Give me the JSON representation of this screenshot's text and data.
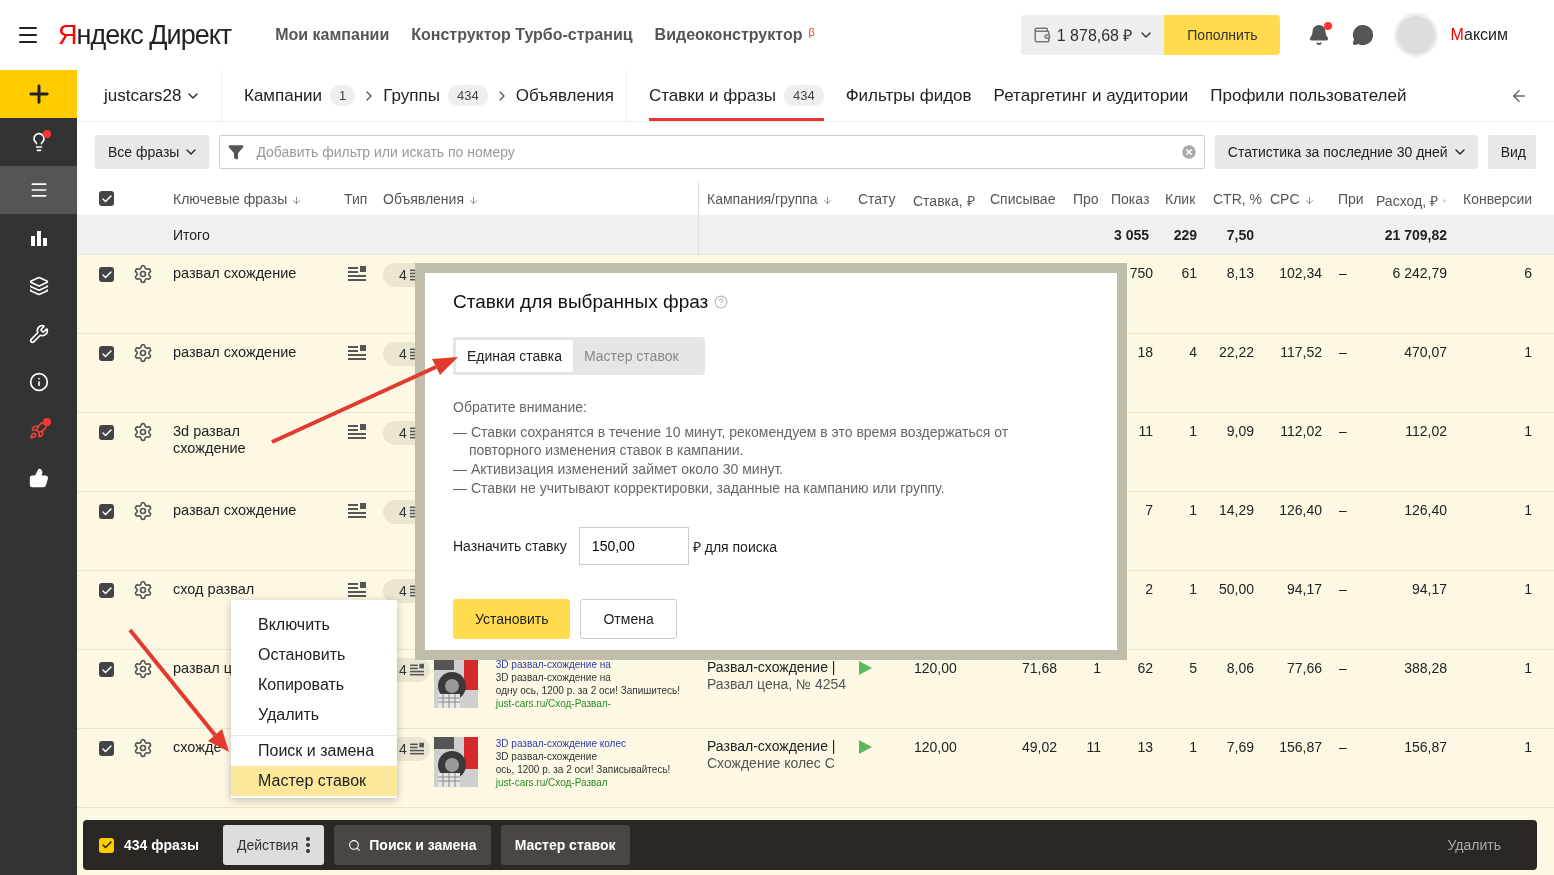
{
  "header": {
    "brand": "Яндекс Директ",
    "nav": [
      {
        "label": "Мои кампании"
      },
      {
        "label": "Конструктор Турбо-страниц"
      },
      {
        "label": "Видеоконструктор",
        "mark": "β"
      }
    ],
    "balance": "1 878,68 ₽",
    "top_up": "Пополнить",
    "notifications_unread": true,
    "user": "Максим"
  },
  "sidebar": {
    "items": [
      {
        "selected": false,
        "badge": true
      },
      {
        "selected": true,
        "badge": false
      },
      {
        "selected": false,
        "badge": false
      },
      {
        "selected": false,
        "badge": false
      },
      {
        "selected": false,
        "badge": false
      },
      {
        "selected": false,
        "badge": false
      },
      {
        "selected": false,
        "badge": true
      },
      {
        "selected": false,
        "badge": false
      }
    ]
  },
  "account": "justcars28",
  "breadcrumbs": [
    {
      "label": "Кампании",
      "count": "1"
    },
    {
      "label": "Группы",
      "count": "434"
    },
    {
      "label": "Объявления"
    }
  ],
  "tabs": [
    {
      "label": "Ставки и фразы",
      "count": "434",
      "selected": true
    },
    {
      "label": "Фильтры фидов",
      "selected": false
    },
    {
      "label": "Ретаргетинг и аудитории",
      "selected": false
    },
    {
      "label": "Профили пользователей",
      "selected": false
    }
  ],
  "filters": {
    "phrase_filter": "Все фразы",
    "search": {
      "placeholder": "Добавить фильтр или искать по номеру"
    },
    "period": "Статистика за последние 30 дней",
    "view": "Вид"
  },
  "table": {
    "header_checked": true,
    "columns": [
      {
        "label": "Ключевые фразы",
        "sortable": true
      },
      {
        "label": "Тип"
      },
      {
        "label": "Объявления",
        "sortable": true
      },
      {
        "label": "Кампания/группа",
        "sortable": true
      },
      {
        "label": "Стату"
      },
      {
        "label": "Ставка, ₽"
      },
      {
        "label": "Списывае"
      },
      {
        "label": "Про"
      },
      {
        "label": "Показ"
      },
      {
        "label": "Клик"
      },
      {
        "label": "CTR, %"
      },
      {
        "label": "CPC",
        "sortable": true
      },
      {
        "label": "При"
      },
      {
        "label": "Расход, ₽",
        "sortable": true
      },
      {
        "label": "Конверсии"
      }
    ],
    "total": {
      "label": "Итого",
      "shows": "3 055",
      "clicks": "229",
      "ctr": "7,50",
      "spend": "21 709,82"
    },
    "rows": [
      {
        "checked": true,
        "phrase": "развал схождение",
        "type_icon": true,
        "ads_count": "4",
        "shows": "750",
        "clicks": "61",
        "ctr": "8,13",
        "cpc": "102,34",
        "pri": "–",
        "spend": "6 242,79",
        "conv": "6"
      },
      {
        "checked": true,
        "phrase": "развал схождение",
        "type_icon": true,
        "ads_count": "4",
        "shows": "18",
        "clicks": "4",
        "ctr": "22,22",
        "cpc": "117,52",
        "pri": "–",
        "spend": "470,07",
        "conv": "1"
      },
      {
        "checked": true,
        "phrase": "3d развал схождение",
        "type_icon": true,
        "ads_count": "4",
        "shows": "11",
        "clicks": "1",
        "ctr": "9,09",
        "cpc": "112,02",
        "pri": "–",
        "spend": "112,02",
        "conv": "1"
      },
      {
        "checked": true,
        "phrase": "развал схождение",
        "type_icon": true,
        "ads_count": "4",
        "shows": "7",
        "clicks": "1",
        "ctr": "14,29",
        "cpc": "126,40",
        "pri": "–",
        "spend": "126,40",
        "conv": "1"
      },
      {
        "checked": true,
        "phrase": "сход развал",
        "type_icon": true,
        "ads_count": "4",
        "shows": "2",
        "clicks": "1",
        "ctr": "50,00",
        "cpc": "94,17",
        "pri": "–",
        "spend": "94,17",
        "conv": "1"
      },
      {
        "checked": true,
        "phrase": "развал ц",
        "ads_count": "4",
        "ad": {
          "title": "3D развал-схождение на",
          "lines": [
            "3D развал-схождение на",
            "одну ось, 1200 р. за 2 оси! Запишитесь!"
          ],
          "url": "just-cars.ru/Сход-Развал-"
        },
        "campaign": [
          "Развал-схождение |",
          "Развал цена, № 4254"
        ],
        "running": true,
        "bid": "120,00",
        "spent": "71,68",
        "pro": "1",
        "shows": "62",
        "clicks": "5",
        "ctr": "8,06",
        "cpc": "77,66",
        "pri": "–",
        "spend": "388,28",
        "conv": "1"
      },
      {
        "checked": true,
        "phrase": "схожде",
        "ads_count": "4",
        "ad": {
          "title": "3D развал-схождение колес",
          "lines": [
            "3D развал-схождение",
            "ось, 1200 р. за 2 оси! Записывайтесь!"
          ],
          "url": "just-cars.ru/Сход-Развал"
        },
        "campaign": [
          "Развал-схождение |",
          "Схождение колес С"
        ],
        "running": true,
        "bid": "120,00",
        "spent": "49,02",
        "pro": "11",
        "shows": "13",
        "clicks": "1",
        "ctr": "7,69",
        "cpc": "156,87",
        "pri": "–",
        "spend": "156,87",
        "conv": "1"
      }
    ]
  },
  "bid_dialog": {
    "title": "Ставки для выбранных фраз",
    "tabs": [
      {
        "label": "Единая ставка",
        "selected": true
      },
      {
        "label": "Мастер ставок",
        "selected": false
      }
    ],
    "note_title": "Обратите внимание:",
    "notes": [
      "— Ставки сохранятся в течение 10 минут, рекомендуем в это время воздержаться от повторного изменения ставок в кампании.",
      "— Активизация изменений займет около 30 минут.",
      "— Ставки не учитывают корректировки, заданные на кампанию или группу."
    ],
    "bid_label": "Назначить ставку",
    "bid_value": "150,00",
    "bid_suffix": "₽ для поиска",
    "buttons": [
      {
        "label": "Установить",
        "primary": true
      },
      {
        "label": "Отмена",
        "primary": false
      }
    ]
  },
  "actions_menu": {
    "items": [
      {
        "label": "Включить",
        "highlighted": false
      },
      {
        "label": "Остановить",
        "highlighted": false
      },
      {
        "label": "Копировать",
        "highlighted": false
      },
      {
        "label": "Удалить",
        "highlighted": false
      },
      {
        "label": "Поиск и замена",
        "highlighted": false,
        "separator_before": true
      },
      {
        "label": "Мастер ставок",
        "highlighted": true
      }
    ]
  },
  "selection_bar": {
    "checked": true,
    "count": "434 фразы",
    "actions": "Действия",
    "buttons": [
      "Поиск и замена",
      "Мастер ставок"
    ],
    "delete": "Удалить"
  }
}
